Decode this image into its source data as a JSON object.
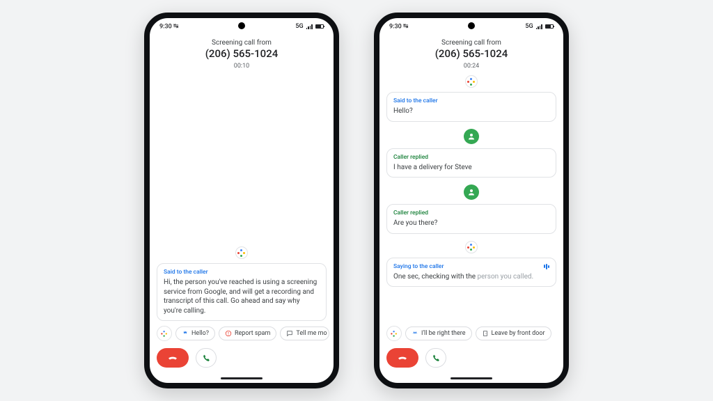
{
  "status": {
    "time": "9:30",
    "network": "5G"
  },
  "phones": [
    {
      "header": {
        "line1": "Screening call from",
        "number": "(206) 565-1024",
        "duration": "00:10"
      },
      "cards": [
        {
          "kind": "assistant",
          "label": "Said to the caller",
          "text": "Hi, the person you've reached is using a screening service from Google, and will get a recording and transcript of this call. Go ahead and say why you're calling."
        }
      ],
      "chips": [
        {
          "icon": "wave",
          "label": "Hello?"
        },
        {
          "icon": "spam",
          "label": "Report spam"
        },
        {
          "icon": "partial",
          "label": "Tell me mo"
        }
      ]
    },
    {
      "header": {
        "line1": "Screening call from",
        "number": "(206) 565-1024",
        "duration": "00:24"
      },
      "cards": [
        {
          "kind": "assistant",
          "label": "Said to the caller",
          "text": "Hello?"
        },
        {
          "kind": "caller",
          "label": "Caller replied",
          "text": "I have a delivery for Steve"
        },
        {
          "kind": "caller",
          "label": "Caller replied",
          "text": "Are you there?"
        },
        {
          "kind": "assistant-live",
          "label": "Saying to the caller",
          "text": "One sec, checking with the ",
          "faded": "person you called."
        }
      ],
      "chips": [
        {
          "icon": "wave",
          "label": "I'll be right there"
        },
        {
          "icon": "door",
          "label": "Leave by front door"
        }
      ]
    }
  ]
}
